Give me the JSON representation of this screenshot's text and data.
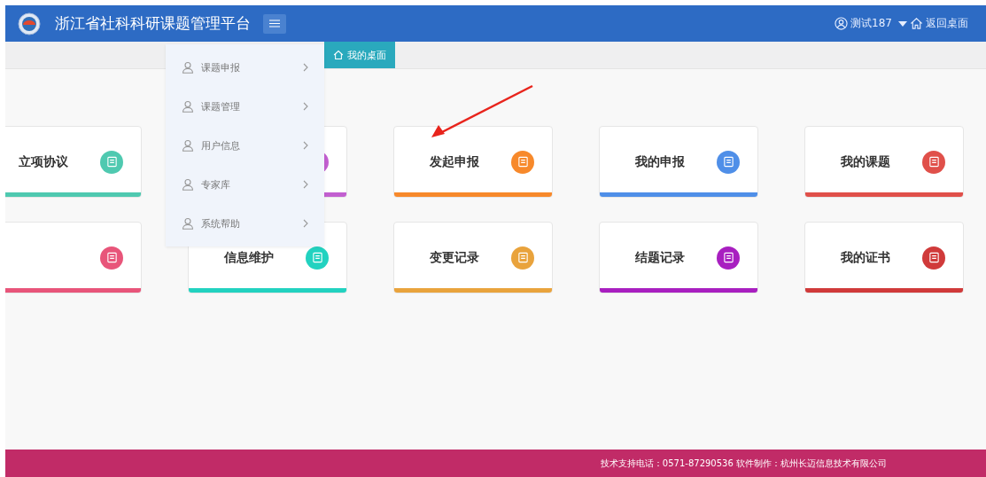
{
  "header": {
    "title": "浙江省社科科研课题管理平台",
    "user": "测试187",
    "home_link": "返回桌面"
  },
  "tabs": [
    {
      "label": "我的桌面",
      "selected": true
    }
  ],
  "menu": {
    "items": [
      {
        "label": "课题申报"
      },
      {
        "label": "课题管理"
      },
      {
        "label": "用户信息"
      },
      {
        "label": "专家库"
      },
      {
        "label": "系统帮助"
      }
    ]
  },
  "cards": [
    [
      {
        "title": "立项协议",
        "color": "#4fc9b0"
      },
      {
        "color": "#c25fd0"
      },
      {
        "title": "发起申报",
        "color": "#f7892b"
      },
      {
        "title": "我的申报",
        "color": "#4f8fe8"
      },
      {
        "title": "我的课题",
        "color": "#e0504a"
      }
    ],
    [
      {
        "color": "#e8557a"
      },
      {
        "title": "信息维护",
        "color": "#22d2c0"
      },
      {
        "title": "变更记录",
        "color": "#e9a33c"
      },
      {
        "title": "结题记录",
        "color": "#a81fc0"
      },
      {
        "title": "我的证书",
        "color": "#d03a3a"
      }
    ]
  ],
  "footer": {
    "text": "技术支持电话：0571-87290536 软件制作：杭州长迈信息技术有限公司"
  }
}
